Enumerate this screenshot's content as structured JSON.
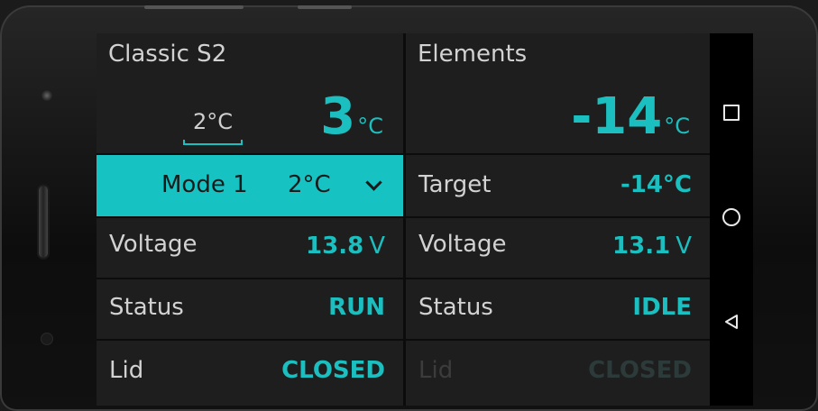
{
  "left_panel": {
    "title": "Classic S2",
    "current_temp": "3",
    "temp_unit": "°C",
    "setpoint": "2°C",
    "mode": {
      "label": "Mode 1",
      "temp": "2°C"
    },
    "voltage": {
      "label": "Voltage",
      "value": "13.8",
      "unit": "V"
    },
    "status": {
      "label": "Status",
      "value": "RUN"
    },
    "lid": {
      "label": "Lid",
      "value": "CLOSED"
    }
  },
  "right_panel": {
    "title": "Elements",
    "current_temp": "-14",
    "temp_unit": "°C",
    "target": {
      "label": "Target",
      "value": "-14°C"
    },
    "voltage": {
      "label": "Voltage",
      "value": "13.1",
      "unit": "V"
    },
    "status": {
      "label": "Status",
      "value": "IDLE"
    },
    "lid": {
      "label": "Lid",
      "value": "CLOSED"
    }
  },
  "navbar": {
    "icons": [
      "recents-square-icon",
      "home-circle-icon",
      "back-triangle-icon"
    ]
  },
  "colors": {
    "accent": "#1cbfbf",
    "cell_bg": "#1e1e1e",
    "text": "#d2d2d2"
  }
}
